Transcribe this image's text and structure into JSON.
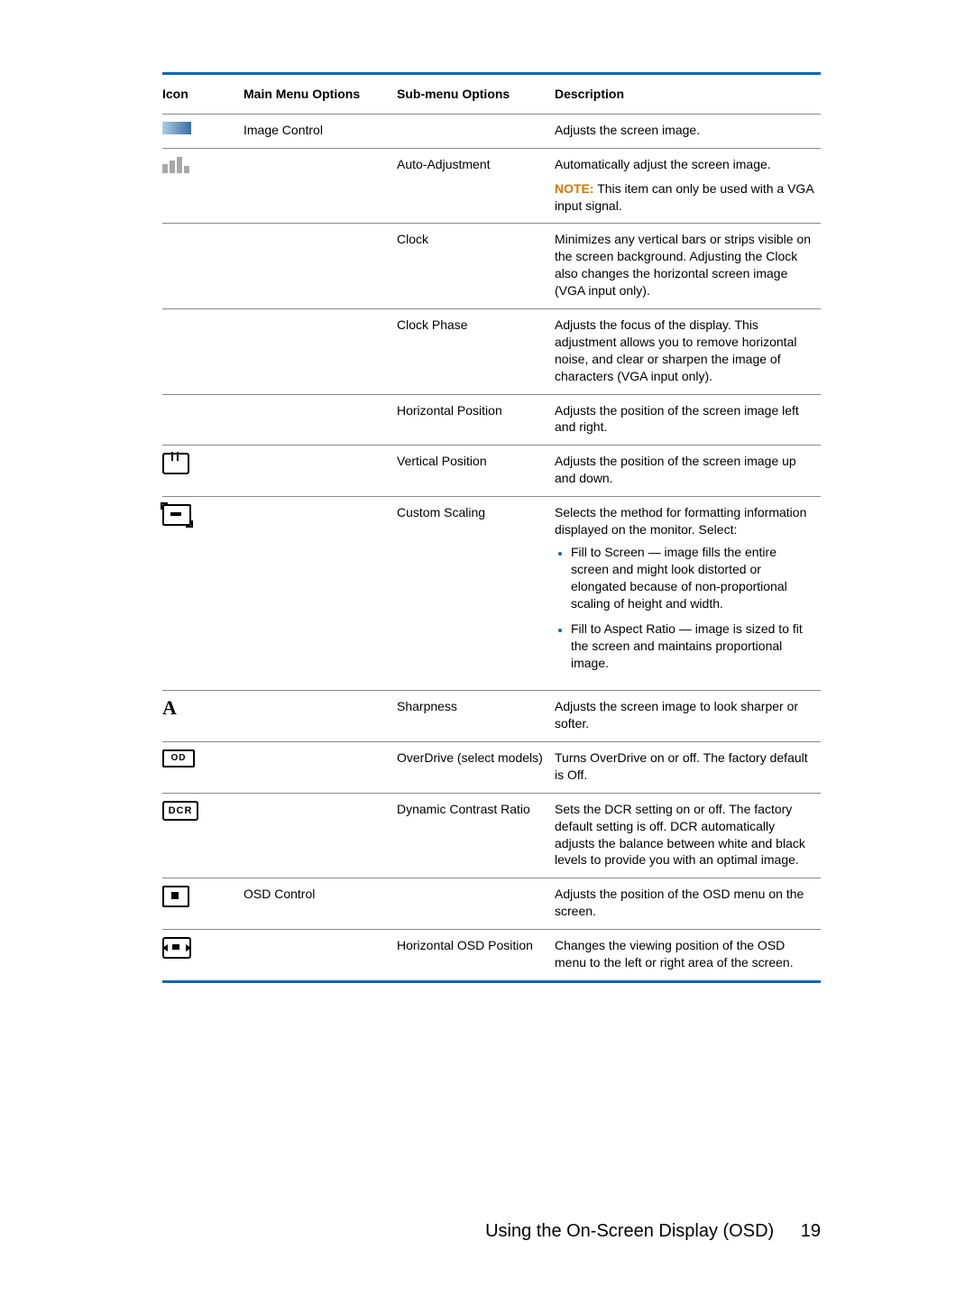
{
  "headers": {
    "icon": "Icon",
    "main": "Main Menu Options",
    "sub": "Sub-menu Options",
    "desc": "Description"
  },
  "rows": [
    {
      "icon": "gradient",
      "main": "Image Control",
      "sub": "",
      "desc_plain": "Adjusts the screen image."
    },
    {
      "icon": "sliders",
      "main": "",
      "sub": "Auto-Adjustment",
      "desc_plain": "Automatically adjust the screen image.",
      "note_label": "NOTE:",
      "note_text": "This item can only be used with a VGA input signal."
    },
    {
      "icon": "",
      "main": "",
      "sub": "Clock",
      "desc_plain": "Minimizes any vertical bars or strips visible on the screen background. Adjusting the Clock also changes the horizontal screen image (VGA input only)."
    },
    {
      "icon": "",
      "main": "",
      "sub": "Clock Phase",
      "desc_plain": "Adjusts the focus of the display. This adjustment allows you to remove horizontal noise, and clear or sharpen the image of characters (VGA input only)."
    },
    {
      "icon": "",
      "main": "",
      "sub": "Horizontal Position",
      "desc_plain": "Adjusts the position of the screen image left and right."
    },
    {
      "icon": "vpos",
      "main": "",
      "sub": "Vertical Position",
      "desc_plain": "Adjusts the position of the screen image up and down."
    },
    {
      "icon": "crop",
      "main": "",
      "sub": "Custom Scaling",
      "desc_plain": "Selects the method for formatting information displayed on the monitor. Select:",
      "bullets": [
        "Fill to Screen — image fills the entire screen and might look distorted or elongated because of non-proportional scaling of height and width.",
        "Fill to Aspect Ratio — image is sized to fit the screen and maintains proportional image."
      ]
    },
    {
      "icon": "A",
      "main": "",
      "sub": "Sharpness",
      "desc_plain": "Adjusts the screen image to look sharper or softer."
    },
    {
      "icon": "od",
      "icon_text": "OD",
      "main": "",
      "sub": "OverDrive (select models)",
      "desc_plain": "Turns OverDrive on or off. The factory default is Off."
    },
    {
      "icon": "dcr",
      "icon_text": "DCR",
      "main": "",
      "sub": "Dynamic Contrast Ratio",
      "desc_plain": "Sets the DCR setting on or off. The factory default setting is off. DCR automatically adjusts the balance between white and black levels to provide you with an optimal image."
    },
    {
      "icon": "osd",
      "main": "OSD Control",
      "sub": "",
      "desc_plain": "Adjusts the position of the OSD menu on the screen."
    },
    {
      "icon": "hosd",
      "main": "",
      "sub": "Horizontal OSD Position",
      "desc_plain": "Changes the viewing position of the OSD menu to the left or right area of the screen."
    }
  ],
  "footer": {
    "title": "Using the On-Screen Display (OSD)",
    "page": "19"
  }
}
